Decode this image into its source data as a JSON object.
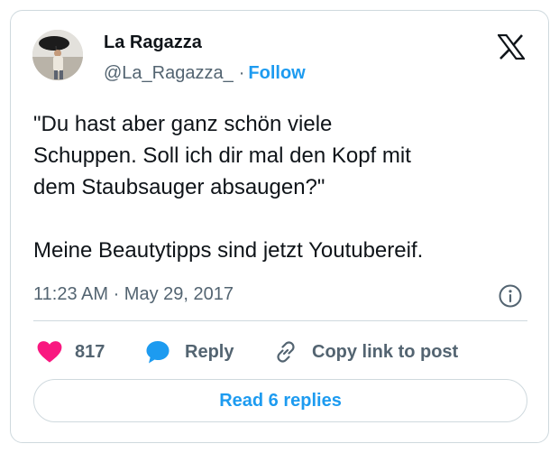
{
  "author": {
    "name": "La Ragazza",
    "handle": "@La_Ragazza_",
    "separator": "·",
    "follow_label": "Follow"
  },
  "tweet": {
    "lines": [
      "\"Du hast aber ganz schön viele",
      "Schuppen. Soll ich dir mal den Kopf mit",
      "dem Staubsauger absaugen?\"",
      "",
      "Meine Beautytipps sind jetzt Youtubereif."
    ],
    "timestamp": "11:23 AM · May 29, 2017"
  },
  "actions": {
    "like_count": "817",
    "reply_label": "Reply",
    "copy_label": "Copy link to post"
  },
  "read_replies_label": "Read 6 replies",
  "colors": {
    "accent": "#1d9bf0",
    "like": "#f91880",
    "text": "#0f1419",
    "muted": "#536471",
    "border": "#cfd9de"
  },
  "icons": {
    "logo": "x-logo-icon",
    "info": "info-icon",
    "like": "heart-icon",
    "reply": "speech-bubble-icon",
    "copy": "link-icon"
  }
}
